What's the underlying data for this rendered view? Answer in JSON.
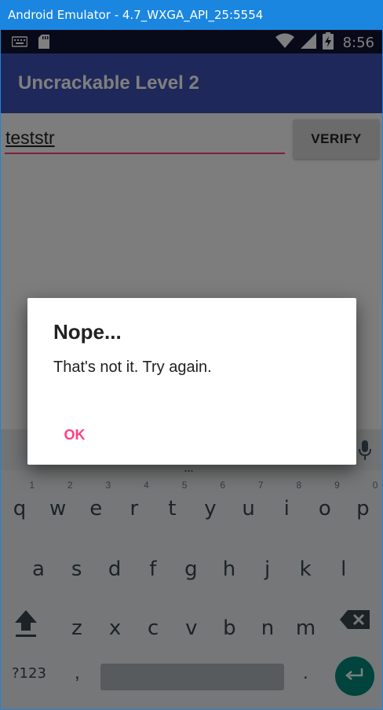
{
  "window": {
    "title": "Android Emulator - 4.7_WXGA_API_25:5554"
  },
  "status_bar": {
    "time": "8:56",
    "left_icons": [
      "keyboard-icon",
      "sd-card-icon"
    ],
    "right_icons": [
      "wifi-icon",
      "cell-signal-icon",
      "battery-charging-icon"
    ]
  },
  "app_bar": {
    "title": "Uncrackable Level 2"
  },
  "form": {
    "input_value": "teststr",
    "verify_label": "VERIFY"
  },
  "dialog": {
    "title": "Nope...",
    "message": "That's not it. Try again.",
    "ok_label": "OK"
  },
  "keyboard": {
    "suggestion_dots": "...",
    "row1": [
      {
        "ch": "q",
        "hint": "1"
      },
      {
        "ch": "w",
        "hint": "2"
      },
      {
        "ch": "e",
        "hint": "3"
      },
      {
        "ch": "r",
        "hint": "4"
      },
      {
        "ch": "t",
        "hint": "5"
      },
      {
        "ch": "y",
        "hint": "6"
      },
      {
        "ch": "u",
        "hint": "7"
      },
      {
        "ch": "i",
        "hint": "8"
      },
      {
        "ch": "o",
        "hint": "9"
      },
      {
        "ch": "p",
        "hint": "0"
      }
    ],
    "row2": [
      "a",
      "s",
      "d",
      "f",
      "g",
      "h",
      "j",
      "k",
      "l"
    ],
    "row3": [
      "z",
      "x",
      "c",
      "v",
      "b",
      "n",
      "m"
    ],
    "symbols_label": "?123",
    "comma_label": ",",
    "period_label": "."
  },
  "colors": {
    "title_bar": "#1a86e0",
    "status_bar": "#101533",
    "app_bar": "#3f51b5",
    "accent": "#ff4081",
    "enter_key": "#00897b"
  }
}
